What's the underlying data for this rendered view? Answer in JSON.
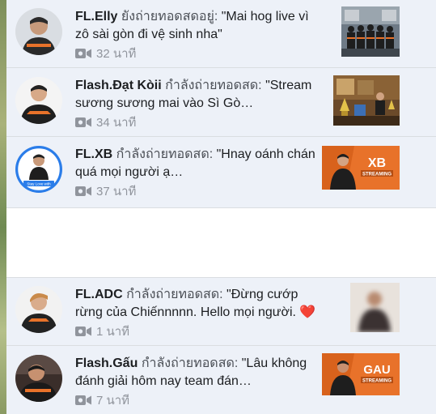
{
  "notifications": [
    {
      "name": "FL.Elly",
      "action": "ยังถ่ายทอดสดอยู่:",
      "message": "\"Mai hog live vì zô sài gòn đi vệ sinh nha\"",
      "time": "32 นาที",
      "thumbnail": "team-photo"
    },
    {
      "name": "Flash.Đạt Kòii",
      "action": "กำลังถ่ายทอดสด:",
      "message": "\"Stream sương sương mai vào Sì Gò…",
      "time": "34 นาที",
      "thumbnail": "trophy-room"
    },
    {
      "name": "FL.XB",
      "action": "กำลังถ่ายทอดสด:",
      "message": "\"Hnay oánh chán quá mọi người ạ…",
      "time": "37 นาที",
      "thumbnail": "streaming-banner",
      "thumbnail_text": "XB",
      "thumbnail_sub": "STREAMING"
    },
    {
      "name": "FL.ADC",
      "action": "กำลังถ่ายทอดสด:",
      "message": "\"Đừng cướp rừng của Chiếnnnnn. Hello mọi người.",
      "emoji": "❤️",
      "time": "1 นาที",
      "thumbnail": "blurred-person"
    },
    {
      "name": "Flash.Gấu",
      "action": "กำลังถ่ายทอดสด:",
      "message": "\"Lâu không đánh giải hôm nay team đán…",
      "time": "7 นาที",
      "thumbnail": "streaming-banner",
      "thumbnail_text": "GAU",
      "thumbnail_sub": "STREAMING"
    }
  ],
  "avatar_badge_text": "Stay Love with",
  "colors": {
    "panel": "#edf1f8",
    "meta_text": "#90949c",
    "banner_orange": "#e8722a",
    "heart": "#e0245e",
    "avatar_ring": "#2b7de9"
  }
}
